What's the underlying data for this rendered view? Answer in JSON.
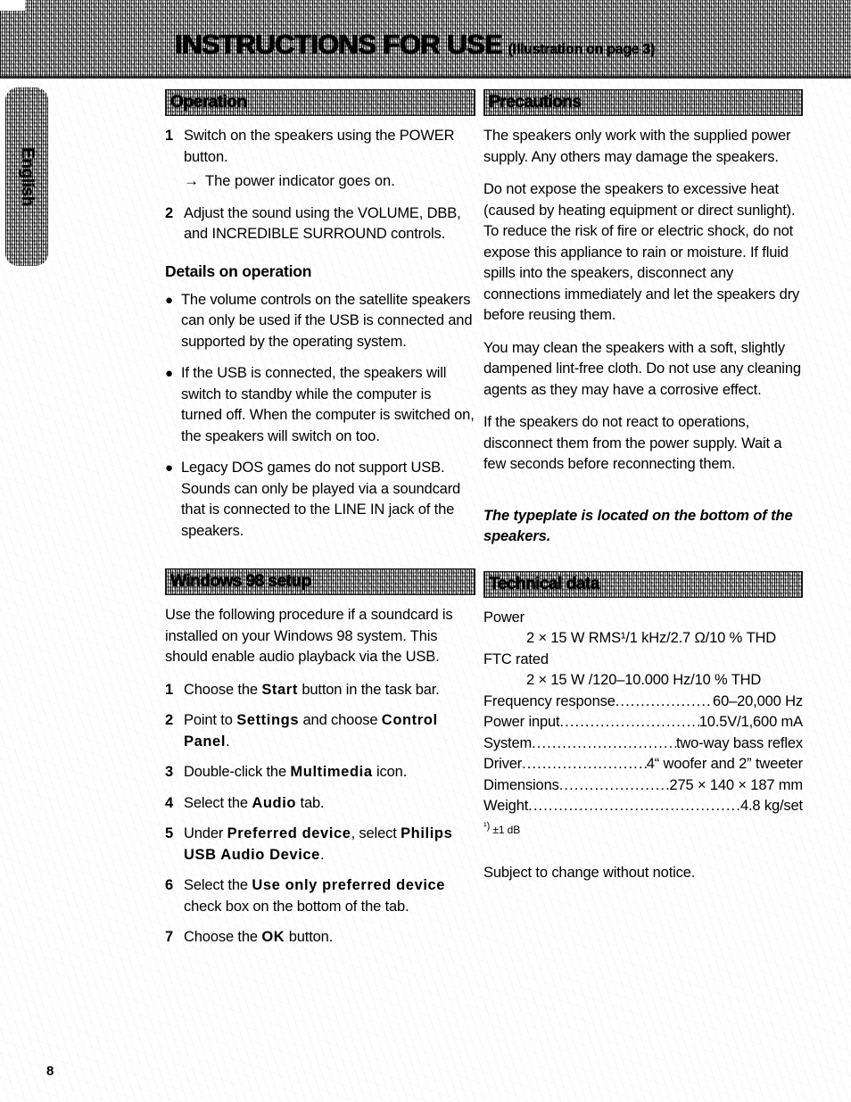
{
  "header": {
    "title": "INSTRUCTIONS FOR USE",
    "subtitle": "(Illustration on page 3)"
  },
  "language_tab": {
    "label": "English"
  },
  "page": {
    "number": "8"
  },
  "left_column": {
    "operation": {
      "heading": "Operation",
      "steps": [
        {
          "num": "1",
          "text": "Switch on the speakers using the POWER button."
        },
        {
          "num": "2",
          "text": "Adjust the sound using the VOLUME, DBB, and INCREDIBLE SURROUND controls."
        }
      ],
      "arrow_note": {
        "arrow": "right-arrow",
        "glyph": "→",
        "text": "The power indicator goes on."
      }
    },
    "details": {
      "heading": "Details on operation",
      "bullets": [
        "The volume controls on the satellite speakers can only be used if the USB is connected and supported by the operating system.",
        "If the USB is connected, the speakers will switch to standby while the computer is turned off. When the computer is switched on, the speakers will switch on too.",
        "Legacy DOS games do not support USB. Sounds can only be played via a soundcard that is connected to the LINE IN jack of the speakers."
      ]
    },
    "windows_setup": {
      "heading": "Windows 98 setup",
      "intro": "Use the following procedure if a soundcard is installed on your Windows 98 system. This should enable audio playback via the USB.",
      "steps": [
        {
          "num": "1",
          "pre": "Choose the ",
          "bold": "Start",
          "post": " button in the task bar."
        },
        {
          "num": "2",
          "pre": "Point to ",
          "bold": "Settings",
          "mid": " and choose ",
          "bold2": "Control Panel",
          "post": "."
        },
        {
          "num": "3",
          "pre": "Double-click the ",
          "bold": "Multimedia",
          "post": " icon."
        },
        {
          "num": "4",
          "pre": "Select the ",
          "bold": "Audio",
          "post": " tab."
        },
        {
          "num": "5",
          "pre": "Under ",
          "bold": "Preferred device",
          "mid": ", select ",
          "bold2": "Philips USB Audio Device",
          "post": "."
        },
        {
          "num": "6",
          "pre": "Select the ",
          "bold": "Use only preferred device",
          "post": " check box on the bottom of the tab."
        },
        {
          "num": "7",
          "pre": "Choose the ",
          "bold": "OK",
          "post": " button."
        }
      ]
    }
  },
  "right_column": {
    "precautions": {
      "heading": "Precautions",
      "paragraphs": [
        "The speakers only work with the supplied power supply. Any others may damage the speakers.",
        "Do not expose the speakers to excessive heat (caused by heating equipment or direct sunlight). To reduce the risk of fire or electric shock, do not expose this appliance to rain or moisture. If fluid spills into the speakers, disconnect any connections immediately and let the speakers dry before reusing them.",
        "You may clean the speakers with a soft, slightly dampened lint-free cloth. Do not use any cleaning agents as they may have a corrosive effect.",
        "If the speakers do not react to operations, disconnect them from the power supply. Wait a few seconds before reconnecting them."
      ],
      "typeplate_note": "The typeplate is located on the bottom of the speakers."
    },
    "technical_data": {
      "heading": "Technical data",
      "power_label": "Power",
      "power_value": "2 × 15 W RMS¹/1 kHz/2.7 Ω/10 % THD",
      "ftc_label": "FTC rated",
      "ftc_value": "2 × 15 W /120–10.000 Hz/10 % THD",
      "specs": [
        {
          "label": "Frequency response",
          "value": "60–20,000 Hz"
        },
        {
          "label": "Power input ",
          "value": "10.5V/1,600 mA"
        },
        {
          "label": "System ",
          "value": "two-way bass reflex"
        },
        {
          "label": "Driver ",
          "value": "4“ woofer and 2” tweeter"
        },
        {
          "label": "Dimensions",
          "value": "275 × 140 × 187 mm"
        },
        {
          "label": "Weight",
          "value": "4.8 kg/set"
        }
      ],
      "footnote_marker": "¹)",
      "footnote_text": "±1 dB",
      "subject_to_change": "Subject to change without notice."
    }
  }
}
